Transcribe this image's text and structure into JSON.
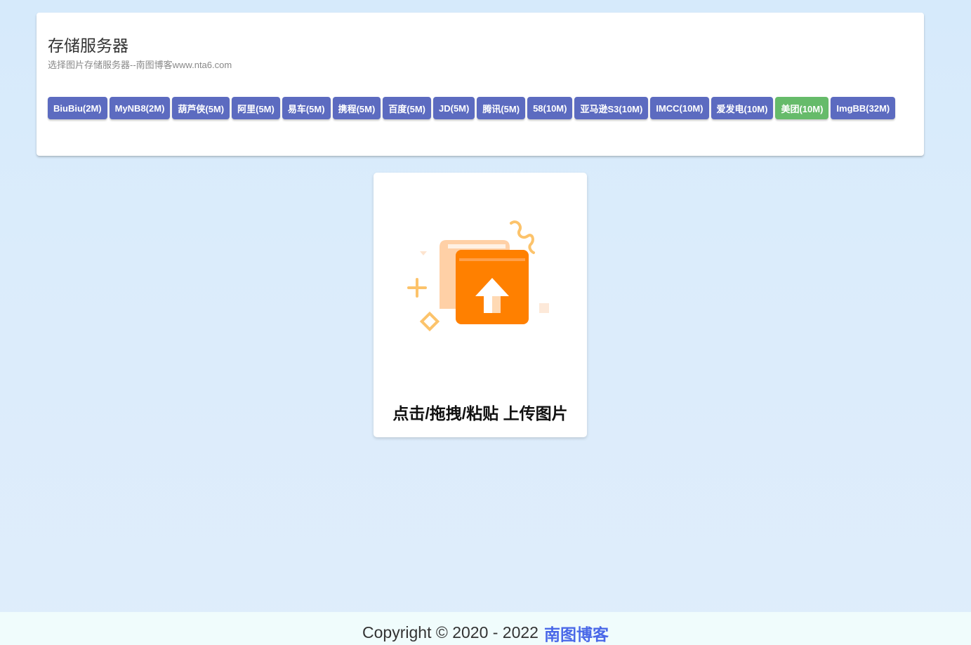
{
  "server_panel": {
    "title": "存储服务器",
    "subtitle": "选择图片存储服务器--南图博客www.nta6.com",
    "servers": [
      {
        "label": "BiuBiu(2M)",
        "active": false
      },
      {
        "label": "MyNB8(2M)",
        "active": false
      },
      {
        "label": "葫芦侠(5M)",
        "active": false
      },
      {
        "label": "阿里(5M)",
        "active": false
      },
      {
        "label": "易车(5M)",
        "active": false
      },
      {
        "label": "携程(5M)",
        "active": false
      },
      {
        "label": "百度(5M)",
        "active": false
      },
      {
        "label": "JD(5M)",
        "active": false
      },
      {
        "label": "腾讯(5M)",
        "active": false
      },
      {
        "label": "58(10M)",
        "active": false
      },
      {
        "label": "亚马逊S3(10M)",
        "active": false
      },
      {
        "label": "IMCC(10M)",
        "active": false
      },
      {
        "label": "爱发电(10M)",
        "active": false
      },
      {
        "label": "美团(10M)",
        "active": true
      },
      {
        "label": "ImgBB(32M)",
        "active": false
      }
    ]
  },
  "upload": {
    "label": "点击/拖拽/粘贴 上传图片",
    "icon": "upload-folder-icon"
  },
  "footer": {
    "copyright": "Copyright © 2020 - 2022",
    "link_text": "南图博客"
  },
  "colors": {
    "button": "#5c6bc0",
    "button_active": "#66bb6a",
    "accent_orange": "#ff7f00",
    "footer_link": "#4a68e8"
  }
}
